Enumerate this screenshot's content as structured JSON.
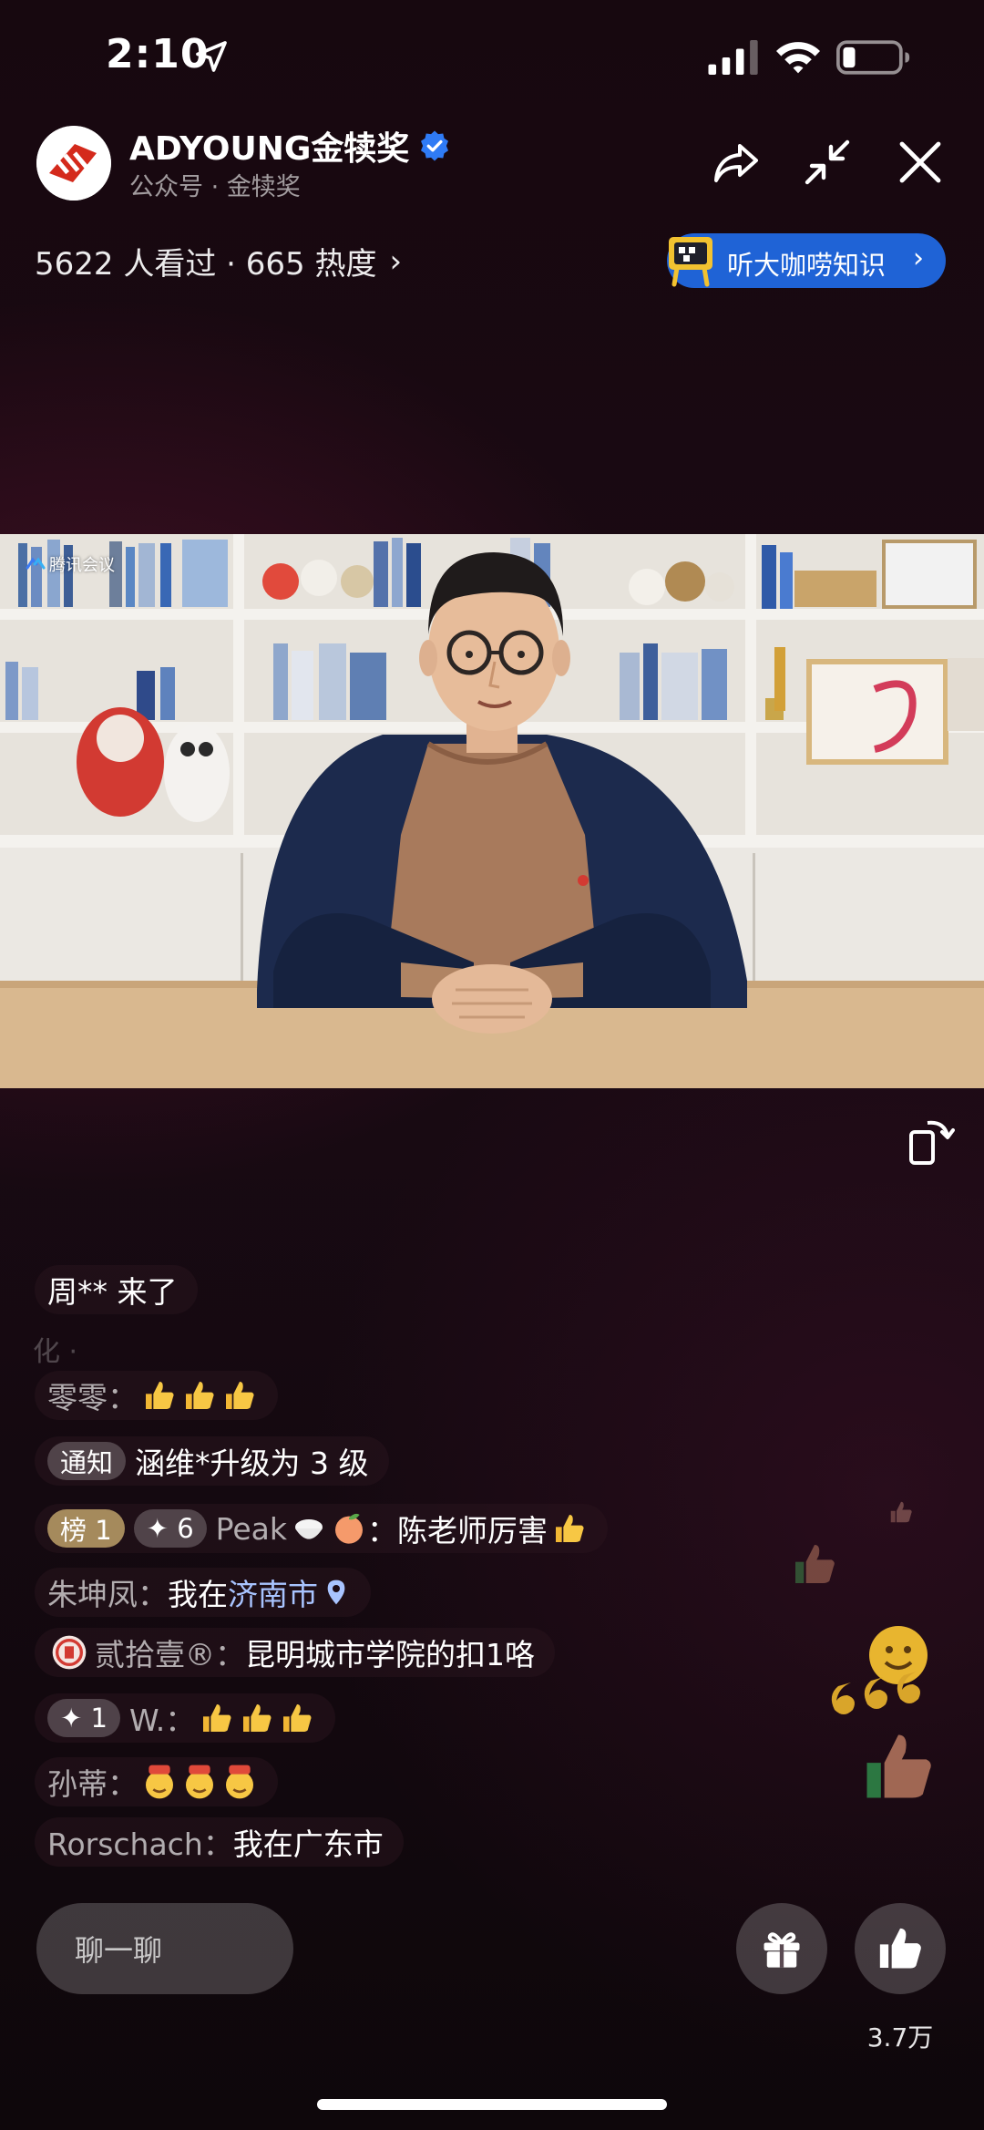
{
  "status_bar": {
    "time": "2:10",
    "icons": [
      "location-arrow-icon",
      "signal-icon",
      "wifi-icon",
      "battery-icon"
    ]
  },
  "header": {
    "channel_name": "ADYOUNG金犊奖",
    "channel_sub": "公众号 · 金犊奖",
    "verified": true,
    "actions": [
      "share-icon",
      "minimize-icon",
      "close-icon"
    ]
  },
  "stats": {
    "text": "5622 人看过 · 665 热度",
    "chevron": "›"
  },
  "promo": {
    "label": "听大咖唠知识",
    "chevron": "›",
    "color": "#1f63d6"
  },
  "video": {
    "meeting_tag": "腾讯会议"
  },
  "chat": {
    "faded": "化 ·",
    "messages": [
      {
        "text": "周** 来了"
      },
      {
        "name": "零零：",
        "emoji": [
          "thumbs-up",
          "thumbs-up",
          "thumbs-up"
        ]
      },
      {
        "badge": "通知",
        "text": "涵维*升级为 3 级"
      },
      {
        "rank_badge": "榜 1",
        "level_badge": "✦ 6",
        "name": "Peak",
        "text": "：陈老师厉害"
      },
      {
        "name": "朱坤凤：",
        "text": "我在",
        "highlight": "济南市"
      },
      {
        "name": "贰拾壹®：",
        "text": "昆明城市学院的扣1咯"
      },
      {
        "level_badge": "✦ 1",
        "name": "W.：",
        "emoji": [
          "thumbs-up",
          "thumbs-up",
          "thumbs-up"
        ]
      },
      {
        "name": "孙蒂：",
        "emoji": [
          "666-face",
          "666-face",
          "666-face"
        ]
      },
      {
        "name": "Rorschach：",
        "text": "我在广东市"
      }
    ]
  },
  "bottom": {
    "chat_placeholder": "聊一聊",
    "like_count": "3.7万"
  },
  "colors": {
    "accent_blue": "#1f63d6",
    "rank_gold": "#a58a5c",
    "highlight": "#a8c4ff"
  }
}
